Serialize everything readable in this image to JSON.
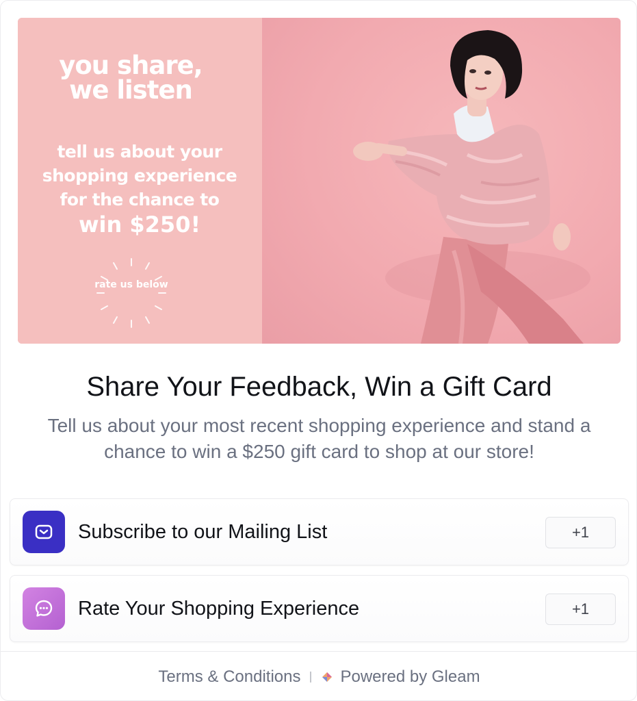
{
  "hero": {
    "heading": "you share, we listen",
    "body": "tell us about your shopping experience for the chance to",
    "prize": "win $250!",
    "cta": "rate us below"
  },
  "title": "Share Your Feedback, Win a Gift Card",
  "description": "Tell us about your most recent shopping experience and stand a chance to win a $250 gift card to shop at our store!",
  "entries": [
    {
      "label": "Subscribe to our Mailing List",
      "points": "+1",
      "icon": "mail-icon",
      "color": "#3a2fc4"
    },
    {
      "label": "Rate Your Shopping Experience",
      "points": "+1",
      "icon": "chat-bubble-icon",
      "color": "#c374da"
    }
  ],
  "footer": {
    "terms": "Terms & Conditions",
    "powered": "Powered by Gleam"
  }
}
